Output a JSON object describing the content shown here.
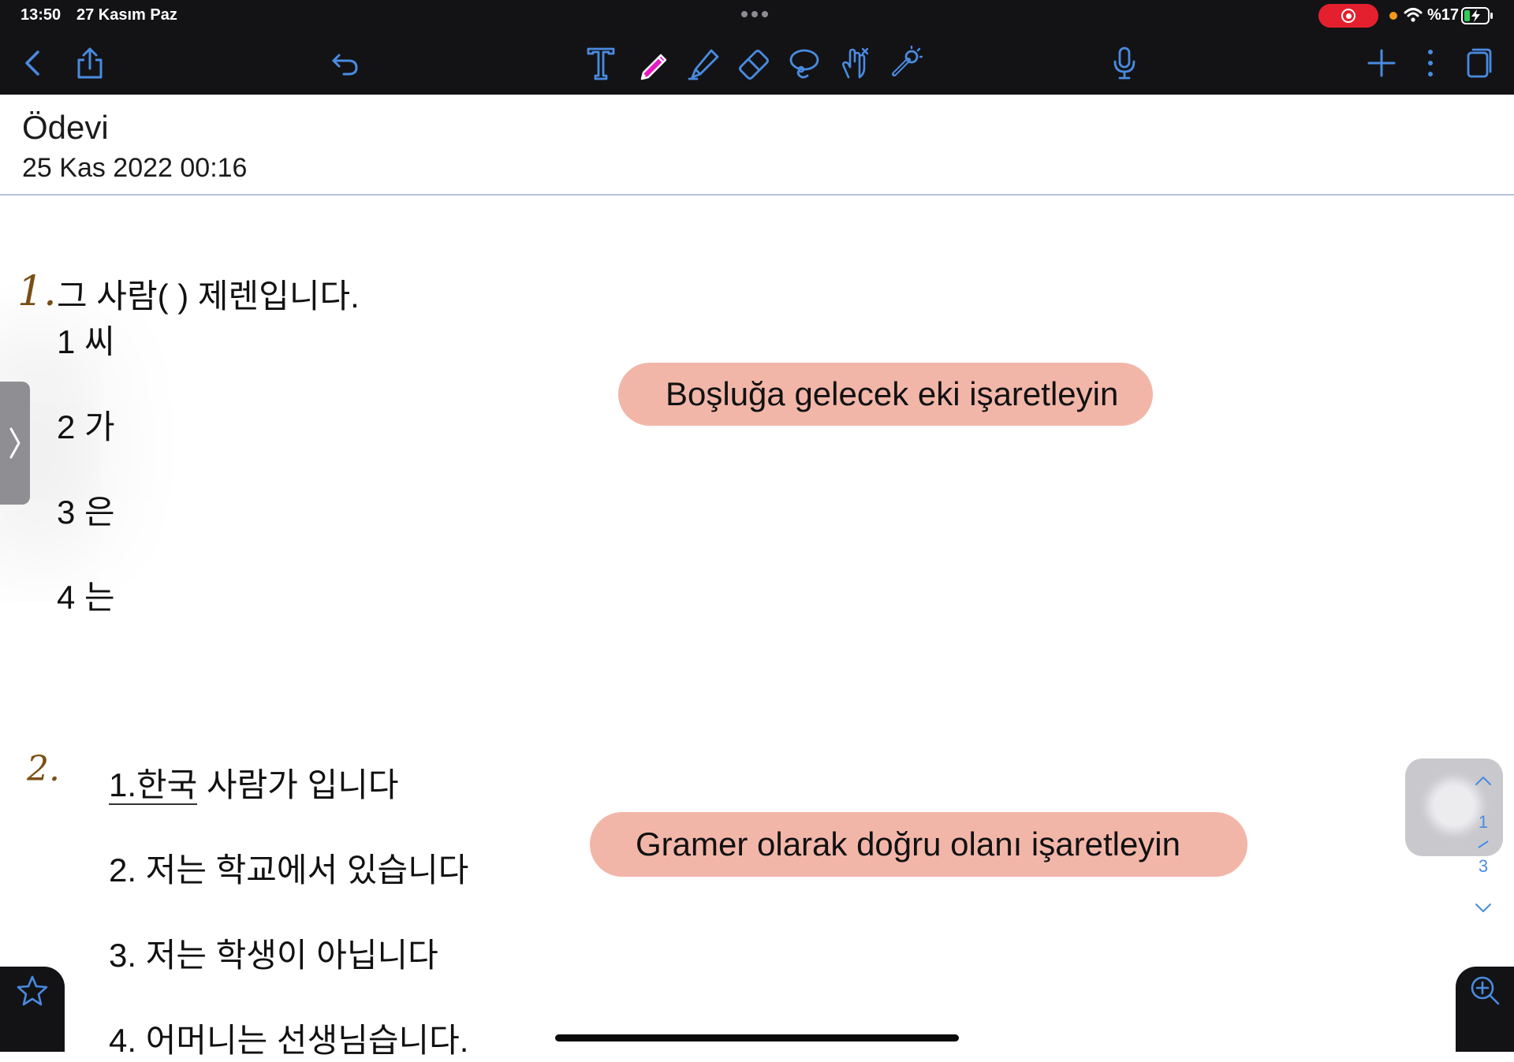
{
  "status_bar": {
    "time": "13:50",
    "date": "27 Kasım Paz",
    "battery": "%17",
    "recording_color": "#e5202e"
  },
  "toolbar": {
    "icons": [
      "back-icon",
      "share-icon",
      "undo-icon",
      "text-tool-icon",
      "pen-icon",
      "highlighter-icon",
      "eraser-icon",
      "lasso-icon",
      "hand-tool-icon",
      "laser-pointer-icon",
      "microphone-icon",
      "add-page-icon",
      "more-icon",
      "pages-icon"
    ],
    "accent": "#4a8be0",
    "pen_color": "#e619c3"
  },
  "document": {
    "title": "Ödevi",
    "date": "25 Kas 2022 00:16"
  },
  "question1": {
    "number": "1.",
    "prompt": "그 사람( ) 제렌입니다.",
    "options": [
      "1 씨",
      "2 가",
      "3 은",
      "4 는"
    ],
    "instruction": "Boşluğa gelecek eki işaretleyin"
  },
  "question2": {
    "number": "2.",
    "option1_underlined": "1.한국",
    "option1_rest": " 사람가 입니다",
    "options": [
      "2. 저는 학교에서 있습니다",
      "3. 저는 학생이 아닙니다",
      "4. 어머니는 선생님습니다."
    ],
    "instruction": "Gramer olarak doğru olanı işaretleyin"
  },
  "page_nav": {
    "current": "1",
    "total": "3"
  },
  "colors": {
    "pill": "#f2b6a9",
    "handwriting": "#7b5016",
    "chrome": "#131316"
  }
}
